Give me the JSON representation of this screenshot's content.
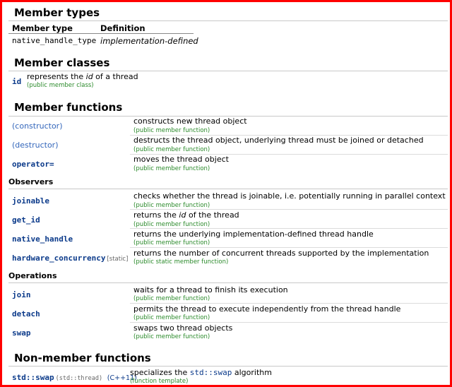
{
  "member_types": {
    "heading": "Member types",
    "col_type": "Member type",
    "col_def": "Definition",
    "row_type": "native_handle_type",
    "row_def": "implementation-defined"
  },
  "member_classes": {
    "heading": "Member classes",
    "name": "id",
    "desc_pre": "represents the ",
    "desc_em": "id",
    "desc_post": " of a thread",
    "note": "(public member class)"
  },
  "member_functions": {
    "heading": "Member functions",
    "rows": [
      {
        "name": "(constructor)",
        "desc": "constructs new thread object",
        "note": "(public member function)"
      },
      {
        "name": "(destructor)",
        "desc": "destructs the thread object, underlying thread must be joined or detached",
        "note": "(public member function)"
      },
      {
        "name": "operator=",
        "desc": "moves the thread object",
        "note": "(public member function)"
      }
    ],
    "observers_label": "Observers",
    "observers": [
      {
        "name": "joinable",
        "desc": "checks whether the thread is joinable, i.e. potentially running in parallel context",
        "note": "(public member function)"
      },
      {
        "name": "get_id",
        "desc_pre": "returns the ",
        "desc_em": "id",
        "desc_post": " of the thread",
        "note": "(public member function)"
      },
      {
        "name": "native_handle",
        "desc": "returns the underlying implementation-defined thread handle",
        "note": "(public member function)"
      },
      {
        "name": "hardware_concurrency",
        "tag": "[static]",
        "desc": "returns the number of concurrent threads supported by the implementation",
        "note": "(public static member function)"
      }
    ],
    "operations_label": "Operations",
    "operations": [
      {
        "name": "join",
        "desc": "waits for a thread to finish its execution",
        "note": "(public member function)"
      },
      {
        "name": "detach",
        "desc": "permits the thread to execute independently from the thread handle",
        "note": "(public member function)"
      },
      {
        "name": "swap",
        "desc": "swaps two thread objects",
        "note": "(public member function)"
      }
    ]
  },
  "non_member": {
    "heading": "Non-member functions",
    "name": "std::swap",
    "name_paren": "(std::thread)",
    "std_tag": "(C++11)",
    "desc_pre": "specializes the ",
    "desc_code": "std::swap",
    "desc_post": " algorithm",
    "note": "(function template)"
  },
  "colors": {
    "frame": "#ff0000",
    "link": "#0b3a8a",
    "note": "#2a8a2a"
  }
}
